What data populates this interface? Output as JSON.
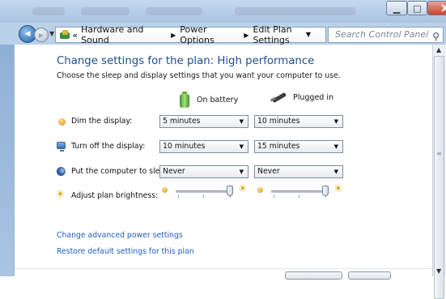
{
  "window": {
    "title": "",
    "min_glyph": "▁",
    "max_glyph": "□",
    "close_glyph": "X"
  },
  "nav": {
    "back_glyph": "◀",
    "forward_glyph": "▶",
    "breadcrumbs": [
      "«",
      "Hardware and Sound",
      "Power Options",
      "Edit Plan Settings"
    ],
    "crumb_separator": "▶",
    "dropdown_glyph": "▼",
    "refresh_glyph": "↻",
    "search_placeholder": "Search Control Panel",
    "search_icon": "⚲"
  },
  "main": {
    "heading": "Change settings for the plan: High performance",
    "subtext": "Choose the sleep and display settings that you want your computer to use.",
    "col_battery": "On battery",
    "col_plugged": "Plugged in",
    "rows": [
      {
        "label": "Dim the display:",
        "battery": "5 minutes",
        "plugged": "10 minutes",
        "icon": "dim-display-icon"
      },
      {
        "label": "Turn off the display:",
        "battery": "10 minutes",
        "plugged": "15 minutes",
        "icon": "monitor-icon"
      },
      {
        "label": "Put the computer to sleep:",
        "battery": "Never",
        "plugged": "Never",
        "icon": "sleep-moon-icon"
      }
    ],
    "brightness": {
      "label": "Adjust plan brightness:",
      "battery_level": 0.95,
      "plugged_level": 0.95
    },
    "select_arrow": "▼",
    "sun_glyph": "☀",
    "links": {
      "advanced": "Change advanced power settings",
      "restore": "Restore default settings for this plan"
    }
  },
  "scrollbar": {
    "up_glyph": "▲",
    "down_glyph": "▼",
    "grip_glyph": "≡"
  }
}
